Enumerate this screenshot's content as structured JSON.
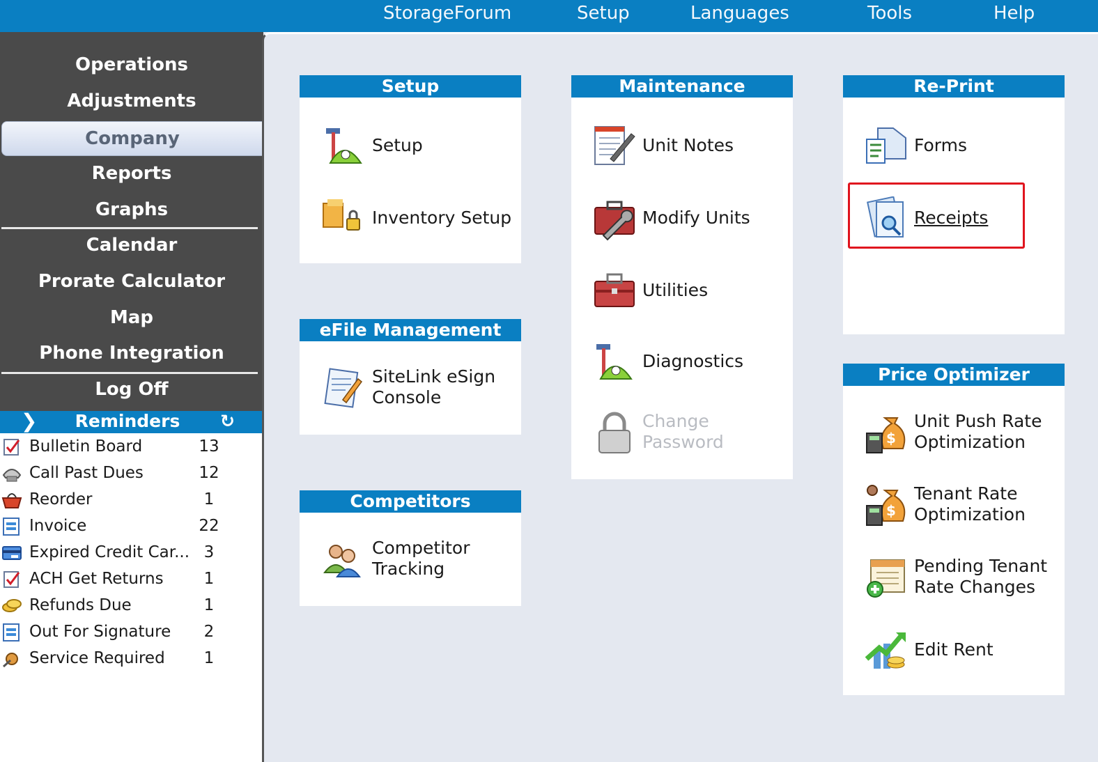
{
  "menu": {
    "items": [
      "StorageForum",
      "Setup",
      "Languages",
      "Tools",
      "Help"
    ]
  },
  "nav": {
    "items": [
      "Operations",
      "Adjustments",
      "Company",
      "Reports",
      "Graphs",
      "Calendar",
      "Prorate Calculator",
      "Map",
      "Phone Integration",
      "Log Off"
    ],
    "active": "Company"
  },
  "reminders": {
    "title": "Reminders",
    "items": [
      {
        "label": "Bulletin Board",
        "count": "13",
        "icon": "checklist-icon"
      },
      {
        "label": "Call Past Dues",
        "count": "12",
        "icon": "phone-icon"
      },
      {
        "label": "Reorder",
        "count": "1",
        "icon": "basket-icon"
      },
      {
        "label": "Invoice",
        "count": "22",
        "icon": "invoice-icon"
      },
      {
        "label": "Expired Credit Car...",
        "count": "3",
        "icon": "credit-card-icon"
      },
      {
        "label": "ACH Get Returns",
        "count": "1",
        "icon": "checklist-icon"
      },
      {
        "label": "Refunds Due",
        "count": "1",
        "icon": "coins-icon"
      },
      {
        "label": "Out For Signature",
        "count": "2",
        "icon": "document-icon"
      },
      {
        "label": "Service Required",
        "count": "1",
        "icon": "service-icon"
      }
    ]
  },
  "groups": {
    "setup": {
      "title": "Setup",
      "items": [
        "Setup",
        "Inventory Setup"
      ]
    },
    "efile": {
      "title": "eFile Management",
      "items": [
        "SiteLink eSign",
        "Console"
      ]
    },
    "competitors": {
      "title": "Competitors",
      "items": [
        "Competitor",
        "Tracking"
      ]
    },
    "maintenance": {
      "title": "Maintenance",
      "items": [
        "Unit Notes",
        "Modify Units",
        "Utilities",
        "Diagnostics",
        "Change",
        "Password"
      ]
    },
    "reprint": {
      "title": "Re-Print",
      "items": [
        "Forms",
        "Receipts"
      ]
    },
    "price": {
      "title": "Price Optimizer",
      "items": [
        "Unit Push Rate",
        "Optimization",
        "Tenant Rate",
        "Optimization",
        "Pending Tenant",
        "Rate Changes",
        "Edit Rent"
      ]
    }
  },
  "colors": {
    "accent": "#0a7fc2",
    "highlight": "#e0141e",
    "nav": "#4a4a4a"
  }
}
